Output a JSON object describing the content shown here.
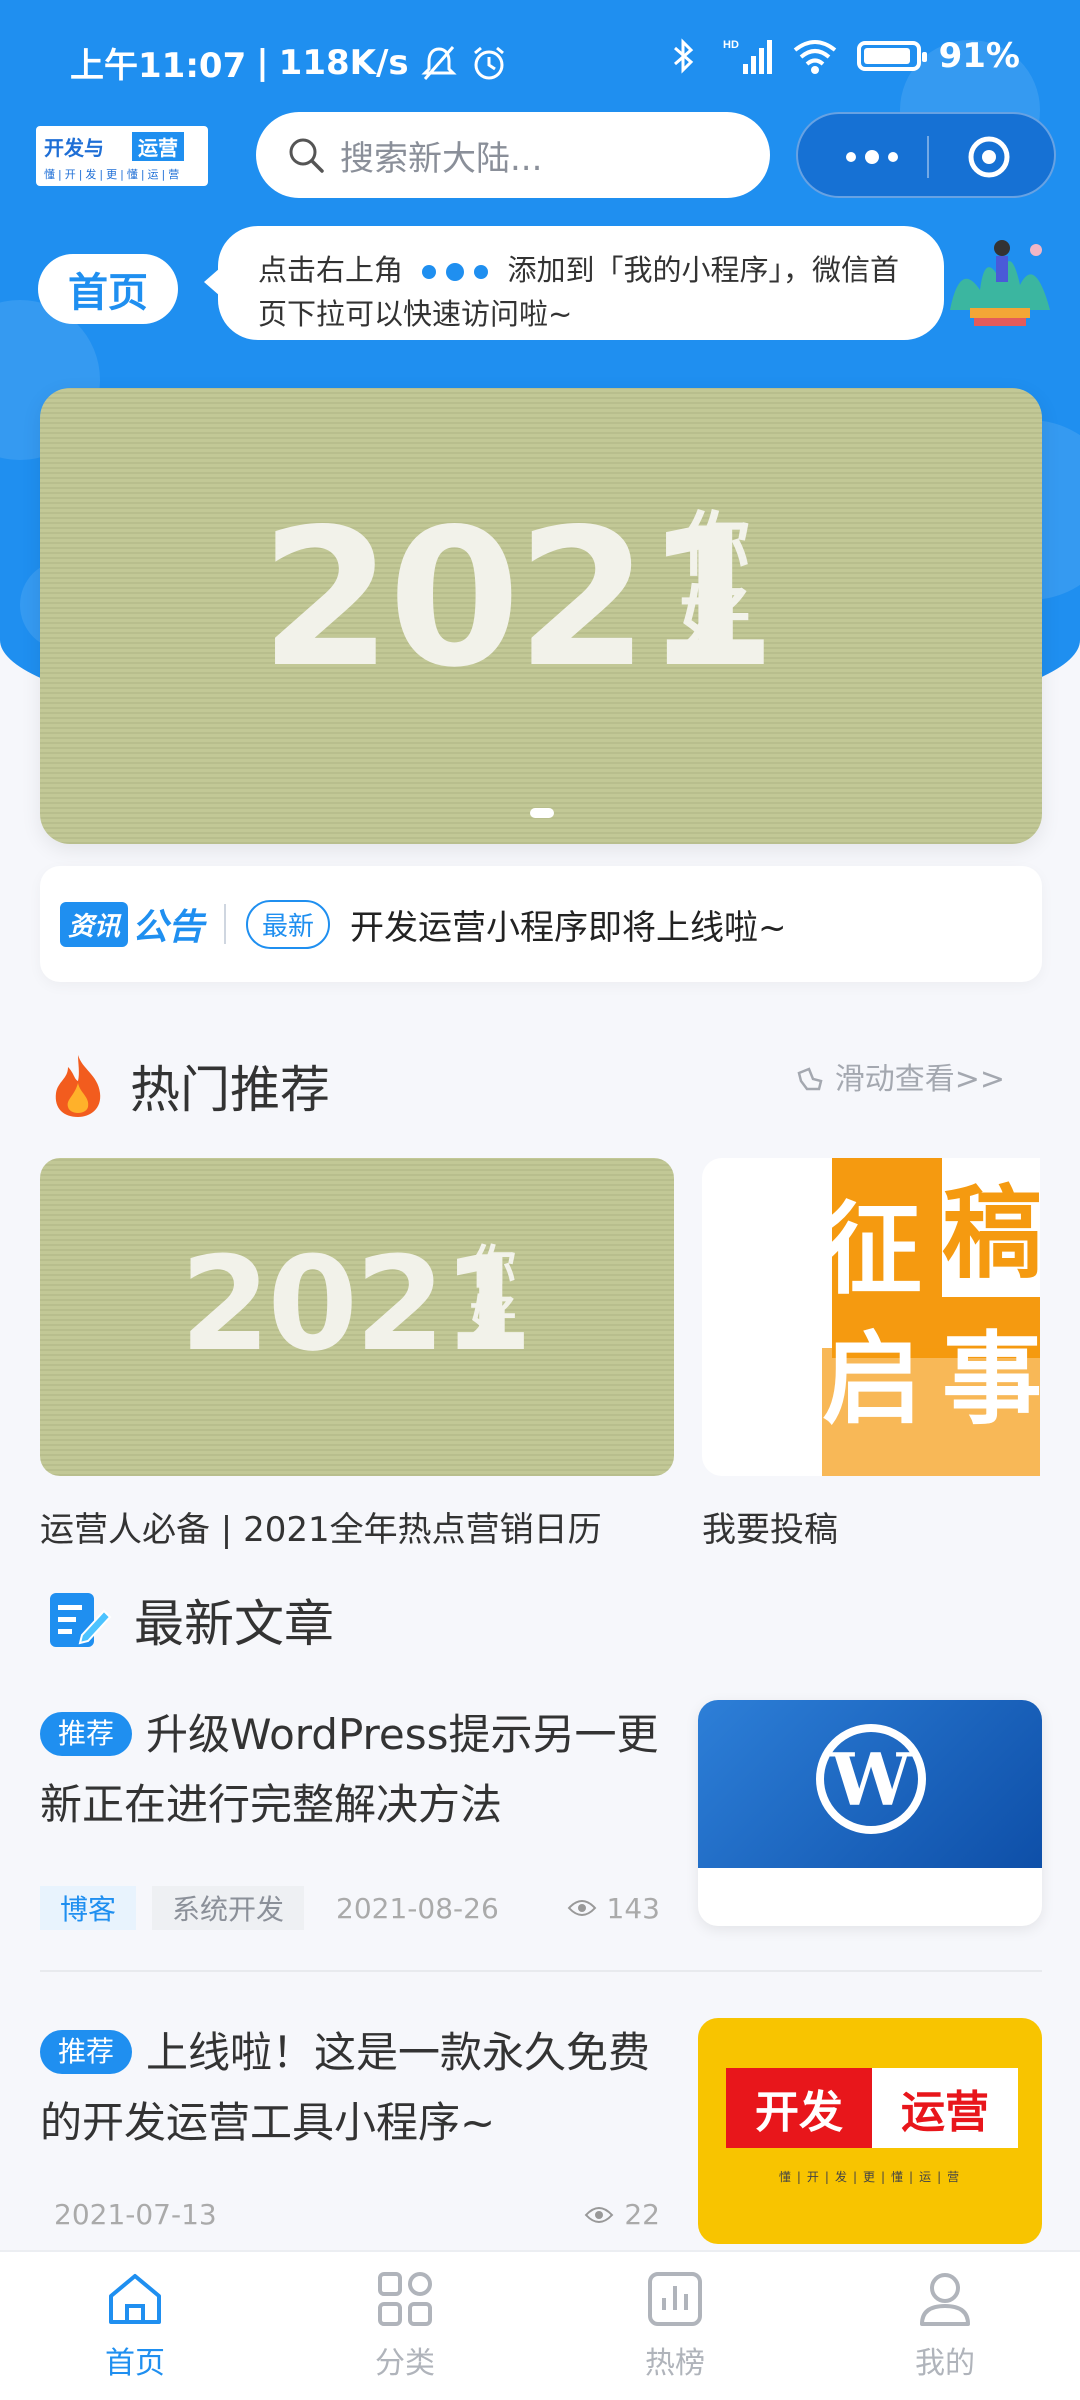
{
  "status_bar": {
    "time": "上午11:07",
    "separator": "|",
    "net_speed": "118K/s",
    "network_badge": "HD",
    "battery": "91%",
    "battery_level": 0.91
  },
  "header": {
    "logo_text_a": "开发与",
    "logo_text_b": "运营",
    "logo_sub": "懂|开|发|更|懂|运|营",
    "search_placeholder": "搜索新大陆...",
    "home_label": "首页"
  },
  "tip": {
    "text_before": "点击右上角",
    "text_after": "添加到「我的小程序」，微信首页下拉可以快速访问啦~"
  },
  "banner": {
    "year_text": "2021",
    "hello_text": "你好",
    "slide_count": 1,
    "active_slide": 1
  },
  "notice": {
    "logo_part1": "资讯",
    "logo_part2": "公告",
    "tag": "最新",
    "text": "开发运营小程序即将上线啦~"
  },
  "hot": {
    "title": "热门推荐",
    "hint": "滑动查看>>",
    "cards": [
      {
        "caption": "运营人必备 | 2021全年热点营销日历",
        "image_year": "2021",
        "image_hello": "你好"
      },
      {
        "caption": "我要投稿",
        "image_chars": [
          "征",
          "稿",
          "启",
          "事"
        ]
      }
    ]
  },
  "latest": {
    "title": "最新文章",
    "articles": [
      {
        "badge": "推荐",
        "title": "升级WordPress提示另一更新正在进行完整解决方法",
        "categories": [
          "博客",
          "系统开发"
        ],
        "date": "2021-08-26",
        "views": "143",
        "thumb_letter": "W"
      },
      {
        "badge": "推荐",
        "title": "上线啦！这是一款永久免费的开发运营工具小程序~",
        "categories": [],
        "date": "2021-07-13",
        "views": "22",
        "thumb_left": "开发",
        "thumb_right": "运营",
        "thumb_sub": "懂|开|发|更|懂|运|营"
      }
    ]
  },
  "tab_bar": {
    "active": 0,
    "items": [
      {
        "label": "首页",
        "icon": "home-icon"
      },
      {
        "label": "分类",
        "icon": "grid-icon"
      },
      {
        "label": "热榜",
        "icon": "chart-icon"
      },
      {
        "label": "我的",
        "icon": "user-icon"
      }
    ]
  },
  "colors": {
    "brand": "#1f8ff0",
    "text": "#333333",
    "muted": "#aaaaaa",
    "banner_bg": "#c2c896",
    "orange": "#f59a10",
    "yellow": "#f8c400",
    "red": "#e8161b"
  }
}
